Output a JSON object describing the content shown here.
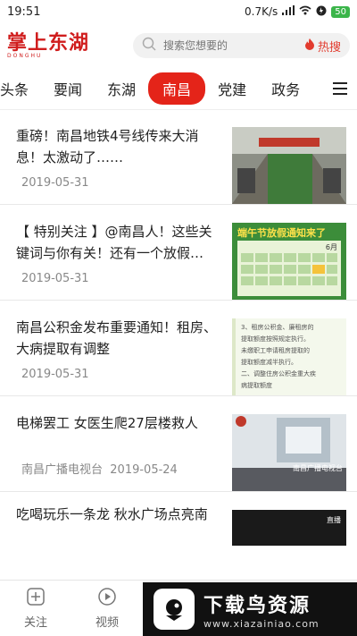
{
  "status": {
    "time": "19:51",
    "speed": "0.7K/s",
    "battery": "50"
  },
  "header": {
    "logo_text": "掌上东湖",
    "logo_sub": "DONGHU",
    "search_placeholder": "搜索您想要的",
    "hot_label": "热搜"
  },
  "tabs": [
    {
      "label": "头条"
    },
    {
      "label": "要闻"
    },
    {
      "label": "东湖"
    },
    {
      "label": "南昌",
      "active": true
    },
    {
      "label": "党建"
    },
    {
      "label": "政务"
    }
  ],
  "feed": [
    {
      "title": "重磅！南昌地铁4号线传来大消息！太激动了……",
      "source": "",
      "date": "2019-05-31"
    },
    {
      "title": "【 特别关注 】@南昌人！这些关键词与你有关！还有一个放假…",
      "source": "",
      "date": "2019-05-31"
    },
    {
      "title": "南昌公积金发布重要通知！租房、大病提取有调整",
      "source": "",
      "date": "2019-05-31"
    },
    {
      "title": "电梯罢工 女医生爬27层楼救人",
      "source": "南昌广播电视台",
      "date": "2019-05-24"
    },
    {
      "title": "吃喝玩乐一条龙 秋水广场点亮南"
    }
  ],
  "thumbs": {
    "t2_title": "端午节放假通知来了",
    "t2_month": "6月",
    "t3_lines": [
      "3、租房公积金、廉租房的",
      "提取额度按照规定执行。",
      "未缴职工申请租房提取的",
      "提取额度减半执行。",
      "二、调整住房公积金重大疾",
      "病提取额度"
    ],
    "t4_caption": "南昌广播电视台",
    "t5_caption": "直播"
  },
  "bottom_nav": [
    {
      "label": "关注"
    },
    {
      "label": "视频"
    }
  ],
  "banner": {
    "title": "下载鸟资源",
    "url": "www.xiazainiao.com"
  },
  "colors": {
    "brand_red": "#e42419",
    "hot_red": "#e23b2e"
  }
}
